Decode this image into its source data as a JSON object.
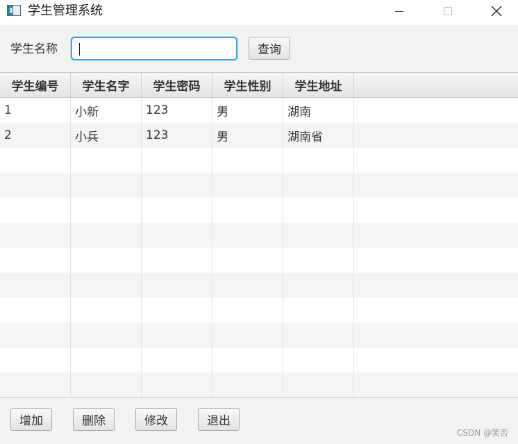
{
  "window": {
    "title": "学生管理系统",
    "icon": "app-window-icon",
    "controls": [
      "minimize-icon",
      "maximize-icon",
      "close-icon"
    ],
    "close_glyph": "✕"
  },
  "search": {
    "label": "学生名称",
    "value": "",
    "query_button": "查询"
  },
  "table": {
    "columns": [
      "学生编号",
      "学生名字",
      "学生密码",
      "学生性别",
      "学生地址"
    ],
    "rows": [
      [
        "1",
        "小新",
        "123",
        "男",
        "湖南"
      ],
      [
        "2",
        "小兵",
        "123",
        "男",
        "湖南省"
      ]
    ]
  },
  "actions": {
    "add": "增加",
    "delete": "删除",
    "edit": "修改",
    "exit": "退出"
  },
  "watermark": "CSDN @笑否",
  "colors": {
    "focus_border": "#3aa3e0",
    "background": "#f3f3f3"
  }
}
